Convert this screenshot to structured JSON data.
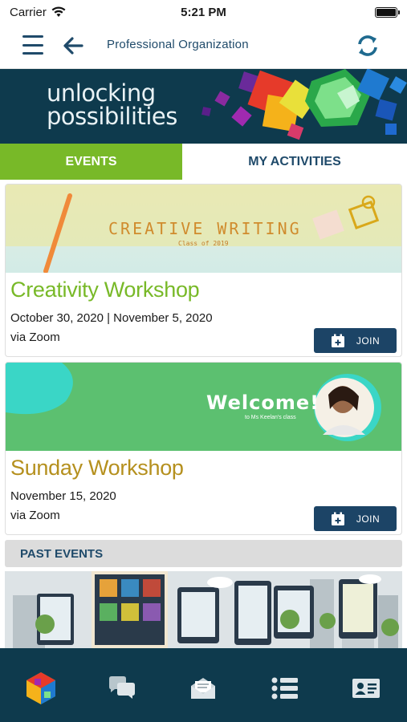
{
  "status_bar": {
    "carrier": "Carrier",
    "time": "5:21 PM"
  },
  "header": {
    "title": "Professional Organization",
    "icons": [
      "menu-icon",
      "back-arrow-icon",
      "refresh-icon"
    ],
    "accent_color": "#1f4a6a"
  },
  "banner": {
    "line1": "unlocking",
    "line2": "possibilities"
  },
  "tabs": [
    {
      "label": "EVENTS",
      "active": true
    },
    {
      "label": "MY ACTIVITIES",
      "active": false
    }
  ],
  "events": [
    {
      "title": "Creativity Workshop",
      "title_color": "#78b928",
      "date": "October 30, 2020 | November 5, 2020",
      "venue": "via Zoom",
      "join_label": "JOIN",
      "image": {
        "headline": "CREATIVE WRITING",
        "subline": "Class of 2019"
      }
    },
    {
      "title": "Sunday Workshop",
      "title_color": "#b5901e",
      "date": "November 15, 2020",
      "venue": "via Zoom",
      "join_label": "JOIN",
      "image": {
        "headline": "Welcome!",
        "subline": "to Ms Keelan's class"
      }
    }
  ],
  "past_events": {
    "label": "PAST EVENTS"
  },
  "bottom_nav": [
    {
      "icon": "app-logo-icon"
    },
    {
      "icon": "chat-icon"
    },
    {
      "icon": "mail-icon"
    },
    {
      "icon": "list-icon"
    },
    {
      "icon": "id-card-icon"
    }
  ],
  "colors": {
    "primary_dark": "#0e3a4d",
    "green": "#78b928",
    "button": "#1c4466"
  }
}
